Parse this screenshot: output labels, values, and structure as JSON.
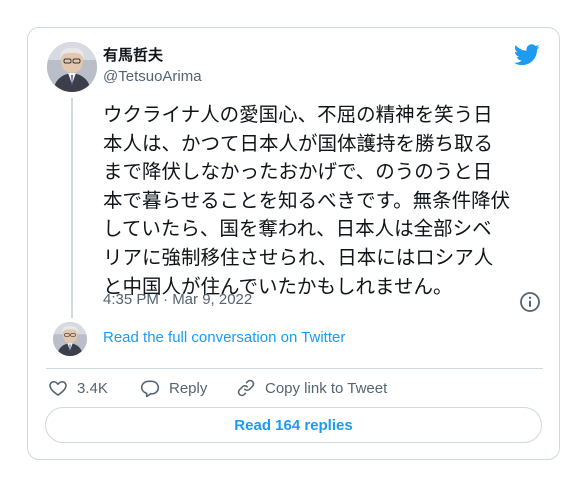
{
  "author": {
    "display_name": "有馬哲夫",
    "handle": "@TetsuoArima"
  },
  "tweet": {
    "lines": [
      "ウクライナ人の愛国心、不屈の精神を笑う日",
      "本人は、かつて日本人が国体護持を勝ち取る",
      "まで降伏しなかったおかげで、のうのうと日",
      "本で暮らせることを知るべきです。無条件降伏",
      "していたら、国を奪われ、日本人は全部シベ",
      "リアに強制移住させられ、日本にはロシア人",
      "と中国人が住んでいたかもしれません。"
    ],
    "timestamp": "4:35 PM · Mar 9, 2022"
  },
  "thread": {
    "read_full_label": "Read the full conversation on Twitter"
  },
  "actions": {
    "like_count": "3.4K",
    "reply_label": "Reply",
    "copy_link_label": "Copy link to Tweet"
  },
  "footer": {
    "read_replies_label": "Read 164 replies"
  },
  "icons": {
    "brand": "twitter-bird-icon",
    "info": "info-icon",
    "like": "heart-icon",
    "reply": "speech-bubble-icon",
    "copy": "link-icon"
  },
  "colors": {
    "accent": "#1d9bf0",
    "text_primary": "#0f1419",
    "text_secondary": "#536471",
    "border": "#cfd9de"
  }
}
